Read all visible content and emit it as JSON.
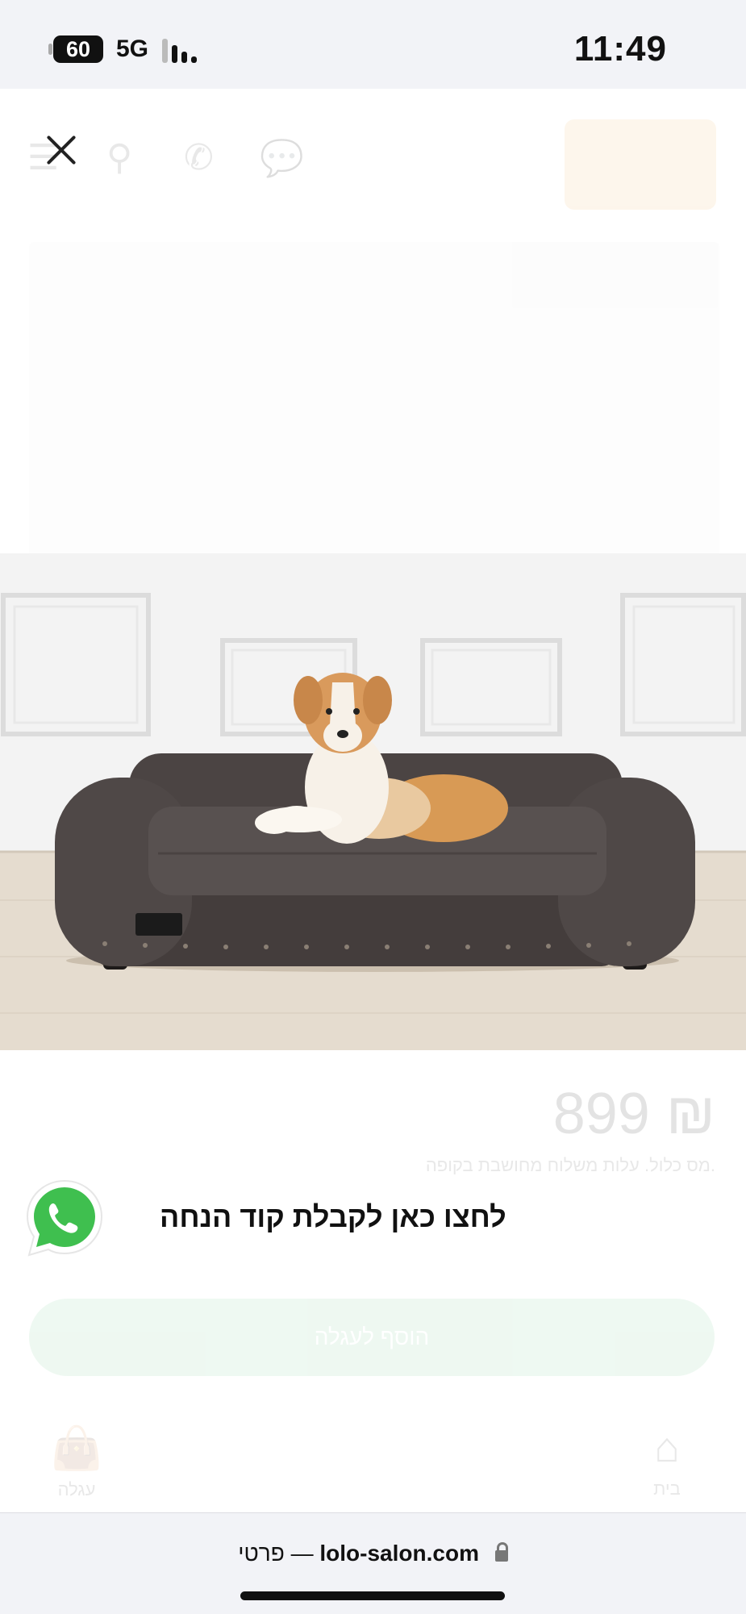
{
  "status_bar": {
    "battery": "60",
    "network": "5G",
    "time": "11:49"
  },
  "background_page": {
    "price": "899 ₪",
    "price_note": "מס כלול. עלות משלוח מחושבת בקופה.",
    "add_to_cart": "הוסף לעגלה",
    "nav_home": "בית",
    "nav_cart": "עגלה"
  },
  "popup": {
    "whatsapp_text": "לחצו כאן לקבלת קוד הנחה",
    "close_icon": "close-icon",
    "whatsapp_icon": "whatsapp-icon",
    "image_subject": "dog on sofa bed"
  },
  "url_bar": {
    "domain": "lolo-salon.com",
    "title": "פרטי",
    "separator": "—",
    "lock_icon": "lock-icon"
  }
}
